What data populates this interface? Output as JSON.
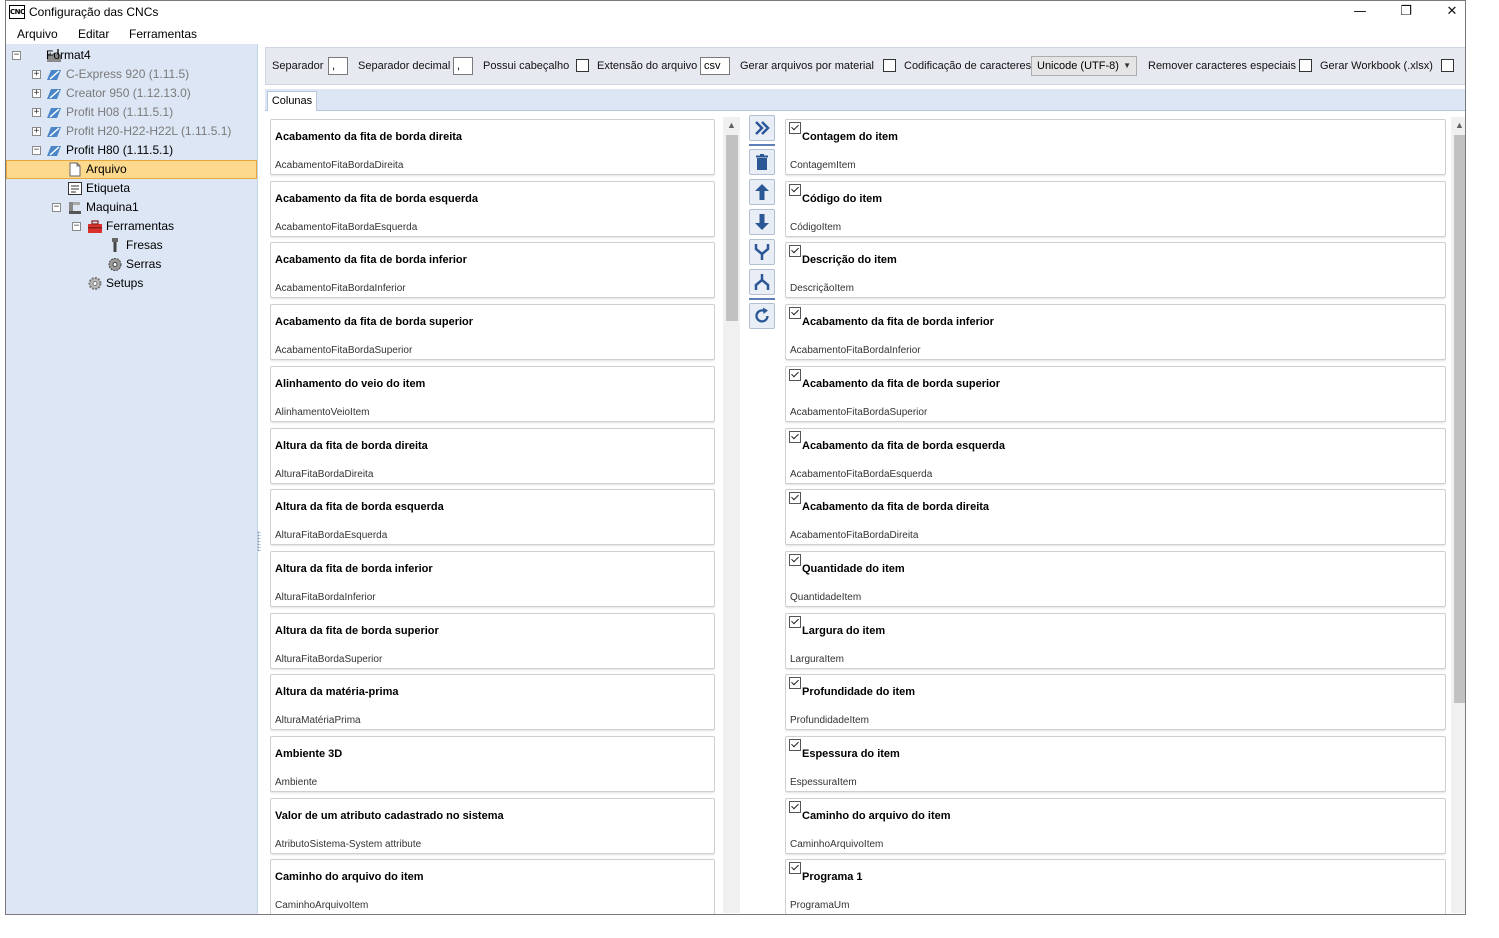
{
  "window": {
    "title": "Configuração das CNCs",
    "app_icon_text": "CNC",
    "controls": {
      "minimize": "—",
      "restore": "❐",
      "close": "✕"
    }
  },
  "menu": {
    "items": [
      "Arquivo",
      "Editar",
      "Ferramentas"
    ]
  },
  "tree": {
    "root": "Format4",
    "machines": [
      {
        "label": "C-Express 920 (1.11.5)",
        "enabled": false
      },
      {
        "label": "Creator 950 (1.12.13.0)",
        "enabled": false
      },
      {
        "label": "Profit H08 (1.11.5.1)",
        "enabled": false
      },
      {
        "label": "Profit H20-H22-H22L (1.11.5.1)",
        "enabled": false
      },
      {
        "label": "Profit H80 (1.11.5.1)",
        "enabled": true
      }
    ],
    "children": {
      "arquivo": "Arquivo",
      "etiqueta": "Etiqueta",
      "maquina": "Maquina1",
      "ferramentas": "Ferramentas",
      "fresas": "Fresas",
      "serras": "Serras",
      "setups": "Setups"
    },
    "selected": "Arquivo"
  },
  "options": {
    "separador_label": "Separador",
    "separador_value": ",",
    "separador_decimal_label": "Separador decimal",
    "separador_decimal_value": ",",
    "possui_cabecalho_label": "Possui cabeçalho",
    "extensao_label": "Extensão do arquivo",
    "extensao_value": "csv",
    "gerar_material_label": "Gerar arquivos por material",
    "codificacao_label": "Codificação de caracteres",
    "codificacao_value": "Unicode (UTF-8)",
    "remover_label": "Remover caracteres especiais",
    "workbook_label": "Gerar Workbook (.xlsx)"
  },
  "tabs": [
    "Colunas"
  ],
  "available_columns": [
    {
      "title": "Acabamento da fita de borda direita",
      "key": "AcabamentoFitaBordaDireita"
    },
    {
      "title": "Acabamento da fita de borda esquerda",
      "key": "AcabamentoFitaBordaEsquerda"
    },
    {
      "title": "Acabamento da fita de borda inferior",
      "key": "AcabamentoFitaBordaInferior"
    },
    {
      "title": "Acabamento da fita de borda superior",
      "key": "AcabamentoFitaBordaSuperior"
    },
    {
      "title": "Alinhamento do veio do item",
      "key": "AlinhamentoVeioItem"
    },
    {
      "title": "Altura da fita de borda direita",
      "key": "AlturaFitaBordaDireita"
    },
    {
      "title": "Altura da fita de borda esquerda",
      "key": "AlturaFitaBordaEsquerda"
    },
    {
      "title": "Altura da fita de borda inferior",
      "key": "AlturaFitaBordaInferior"
    },
    {
      "title": "Altura da fita de borda superior",
      "key": "AlturaFitaBordaSuperior"
    },
    {
      "title": "Altura da matéria-prima",
      "key": "AlturaMatériaPrima"
    },
    {
      "title": "Ambiente 3D",
      "key": "Ambiente"
    },
    {
      "title": "Valor de um atributo cadastrado no sistema",
      "key": "AtributoSistema-System attribute"
    },
    {
      "title": "Caminho do arquivo do item",
      "key": "CaminhoArquivoItem"
    }
  ],
  "selected_columns": [
    {
      "title": "Contagem do item",
      "key": "ContagemItem"
    },
    {
      "title": "Código do item",
      "key": "CódigoItem"
    },
    {
      "title": "Descrição do item",
      "key": "DescriçãoItem"
    },
    {
      "title": "Acabamento da fita de borda inferior",
      "key": "AcabamentoFitaBordaInferior"
    },
    {
      "title": "Acabamento da fita de borda superior",
      "key": "AcabamentoFitaBordaSuperior"
    },
    {
      "title": "Acabamento da fita de borda esquerda",
      "key": "AcabamentoFitaBordaEsquerda"
    },
    {
      "title": "Acabamento da fita de borda direita",
      "key": "AcabamentoFitaBordaDireita"
    },
    {
      "title": "Quantidade do item",
      "key": "QuantidadeItem"
    },
    {
      "title": "Largura do item",
      "key": "LarguraItem"
    },
    {
      "title": "Profundidade do item",
      "key": "ProfundidadeItem"
    },
    {
      "title": "Espessura do item",
      "key": "EspessuraItem"
    },
    {
      "title": "Caminho do arquivo do item",
      "key": "CaminhoArquivoItem"
    },
    {
      "title": "Programa 1",
      "key": "ProgramaUm"
    }
  ],
  "toolbar_icons": [
    "add-all-icon",
    "delete-icon",
    "move-up-icon",
    "move-down-icon",
    "merge-icon",
    "split-icon",
    "refresh-icon"
  ],
  "colors": {
    "tree_bg": "#dce6f4",
    "selection": "#fcd98c",
    "accent": "#2b5797"
  }
}
